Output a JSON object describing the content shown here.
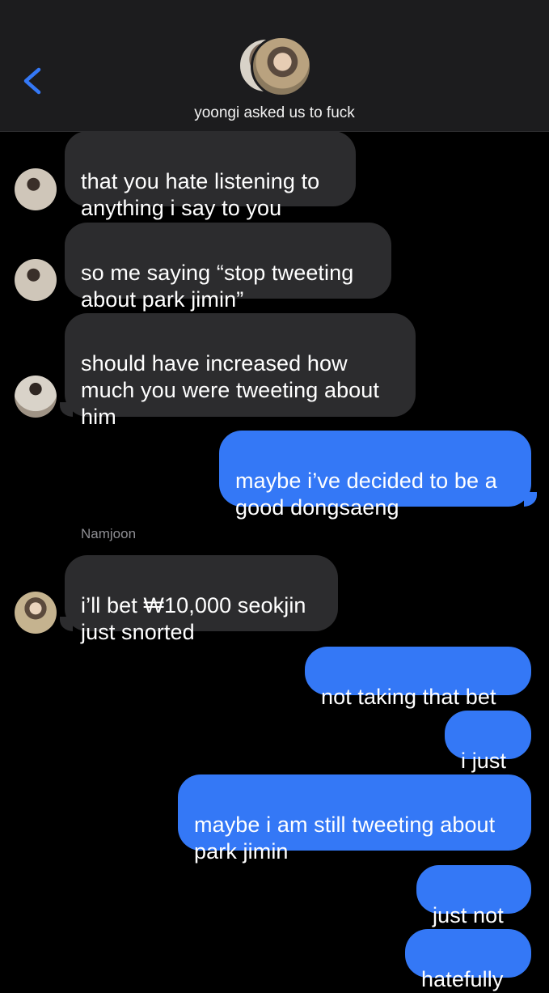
{
  "header": {
    "title": "yoongi asked us to fuck",
    "back_icon": "chevron-left-icon",
    "accent": "#3478f6"
  },
  "colors": {
    "incoming_bubble": "#2c2c2e",
    "outgoing_bubble": "#3478f6",
    "background": "#000000",
    "header_bg": "#1c1c1e"
  },
  "messages": [
    {
      "direction": "incoming",
      "text": "that you hate listening to\nanything i say to you"
    },
    {
      "direction": "incoming",
      "text": "so me saying “stop tweeting\nabout park jimin”"
    },
    {
      "direction": "incoming",
      "text": "should have increased how\nmuch you were tweeting about\nhim"
    },
    {
      "direction": "outgoing",
      "text": "maybe i’ve decided to be a\ngood dongsaeng"
    },
    {
      "direction": "incoming",
      "sender": "Namjoon",
      "text": "i’ll bet ₩10,000 seokjin\njust snorted"
    },
    {
      "direction": "outgoing",
      "text": "not taking that bet"
    },
    {
      "direction": "outgoing",
      "text": "i just"
    },
    {
      "direction": "outgoing",
      "text": "maybe i am still tweeting about\npark jimin"
    },
    {
      "direction": "outgoing",
      "text": "just not"
    },
    {
      "direction": "outgoing",
      "text": "hatefully"
    }
  ]
}
